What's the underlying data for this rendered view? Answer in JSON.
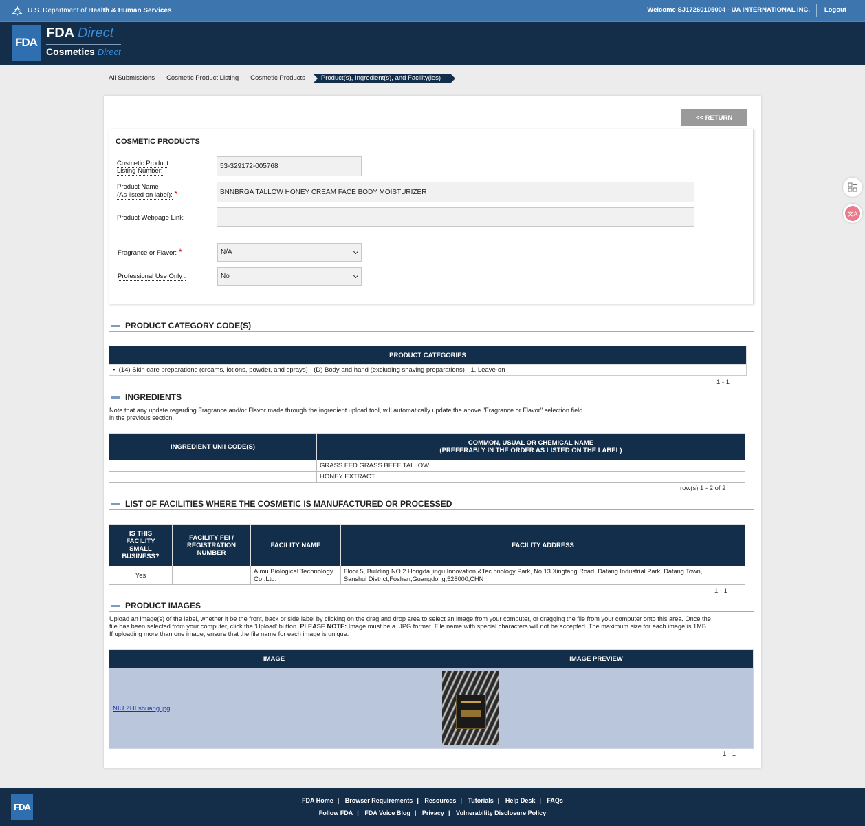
{
  "topbar": {
    "hhs_prefix": "U.S. Department of",
    "hhs_bold": "Health & Human Services",
    "welcome": "Welcome SJ17260105004 - UA INTERNATIONAL INC.",
    "logout": "Logout"
  },
  "header": {
    "badge": "FDA",
    "brand_fda": "FDA",
    "brand_direct": "Direct",
    "brand_cosmetics": "Cosmetics",
    "brand_cosmetics_direct": "Direct"
  },
  "breadcrumb": [
    "All Submissions",
    "Cosmetic Product Listing",
    "Cosmetic Products",
    "Product(s), Ingredient(s), and Facility(ies)"
  ],
  "return_label": "<< RETURN",
  "cosmetic_products": {
    "title": "COSMETIC PRODUCTS",
    "listing_label_1": "Cosmetic Product",
    "listing_label_2": "Listing Number:",
    "listing_value": "53-329172-005768",
    "name_label_1": "Product Name",
    "name_label_2": "(As listed on label):",
    "name_value": "BNNBRGA TALLOW HONEY CREAM FACE BODY MOISTURIZER",
    "webpage_label": "Product Webpage Link:",
    "webpage_value": "",
    "fragrance_label": "Fragrance or Flavor:",
    "fragrance_value": "N/A",
    "professional_label": "Professional Use Only :",
    "professional_value": "No",
    "required_mark": "*"
  },
  "category_section": {
    "title": "PRODUCT CATEGORY CODE(S)",
    "header": "PRODUCT CATEGORIES",
    "rows": [
      "(14) Skin care preparations (creams, lotions, powder, and sprays) - (D) Body and hand (excluding shaving preparations) - 1. Leave-on"
    ],
    "bullet": "▪",
    "pager": "1 - 1"
  },
  "ingredients_section": {
    "title": "INGREDIENTS",
    "note_1": "Note that any update regarding Fragrance and/or Flavor made through the ingredient upload tool, will automatically update the above \"Fragrance or Flavor\" selection field",
    "note_2": "in the previous section.",
    "header_unii": "INGREDIENT UNII CODE(S)",
    "header_name_1": "COMMON, USUAL OR CHEMICAL NAME",
    "header_name_2": "(PREFERABLY IN THE ORDER AS LISTED ON THE LABEL)",
    "rows": [
      {
        "unii": "",
        "name": "GRASS FED GRASS BEEF TALLOW"
      },
      {
        "unii": "",
        "name": "HONEY EXTRACT"
      }
    ],
    "pager": "row(s) 1 - 2 of 2"
  },
  "facilities_section": {
    "title": "LIST OF FACILITIES WHERE THE COSMETIC IS MANUFACTURED OR PROCESSED",
    "h_small_1": "IS THIS",
    "h_small_2": "FACILITY",
    "h_small_3": "SMALL",
    "h_small_4": "BUSINESS?",
    "h_fei_1": "FACILITY FEI /",
    "h_fei_2": "REGISTRATION",
    "h_fei_3": "NUMBER",
    "h_name": "FACILITY NAME",
    "h_address": "FACILITY ADDRESS",
    "rows": [
      {
        "small": "Yes",
        "fei": "",
        "name_1": "Aimu Biological Technology",
        "name_2": "Co.,Ltd.",
        "address_1": "Floor 5, Building NO.2 Hongda jingu Innovation &Tec hnology Park, No.13 Xingtang Road, Datang Industrial Park, Datang Town,",
        "address_2": "Sanshui District,Foshan,Guangdong,528000,CHN"
      }
    ],
    "pager": "1 - 1"
  },
  "images_section": {
    "title": "PRODUCT IMAGES",
    "note_1": "Upload an image(s) of the label, whether it be the front, back or side label by clicking on the drag and drop area to select an image from your computer, or dragging the file from your computer onto this area. Once the",
    "note_2a": "file has been selected from your computer, click the 'Upload' button.",
    "note_2b": "PLEASE NOTE:",
    "note_2c": "Image must be a .JPG format. File name with special characters will not be accepted. The maximum size for each image is 1MB.",
    "note_3": "If uploading more than one image, ensure that the file name for each image is unique.",
    "header_image": "IMAGE",
    "header_preview": "IMAGE PREVIEW",
    "file_name": "NIU ZHI shuang.jpg",
    "pager": "1 - 1"
  },
  "footer": {
    "badge": "FDA",
    "row1": [
      "FDA Home",
      "Browser Requirements",
      "Resources",
      "Tutorials",
      "Help Desk",
      "FAQs"
    ],
    "row2": [
      "Follow FDA",
      "FDA Voice Blog",
      "Privacy",
      "Vulnerability Disclosure Policy"
    ],
    "separator": "|"
  },
  "side_icons": {
    "translate_glyph": "文A"
  },
  "colors": {
    "navy": "#132e4a",
    "topbar": "#3d76ae",
    "accent_blue": "#3b8ddb",
    "image_row": "#b9c6dc"
  }
}
